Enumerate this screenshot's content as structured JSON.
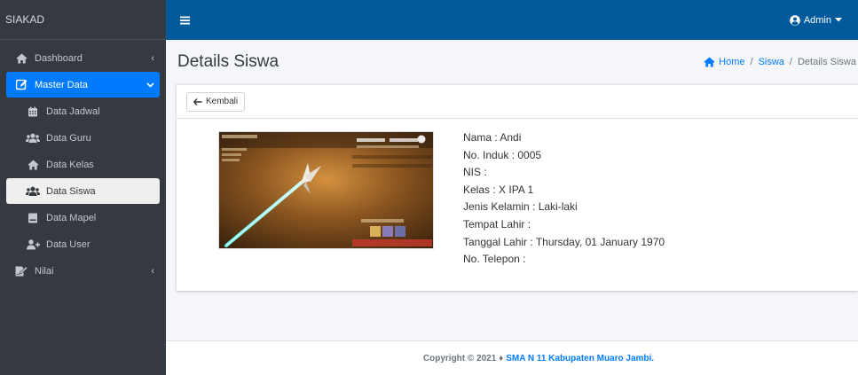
{
  "brand": "SIAKAD",
  "sidebar": {
    "items": [
      {
        "label": "Dashboard",
        "icon": "home-icon",
        "chevron": "‹"
      },
      {
        "label": "Master Data",
        "icon": "edit-icon",
        "chevron": "⌄"
      },
      {
        "label": "Data Jadwal",
        "icon": "calendar-icon"
      },
      {
        "label": "Data Guru",
        "icon": "users-icon"
      },
      {
        "label": "Data Kelas",
        "icon": "home-icon"
      },
      {
        "label": "Data Siswa",
        "icon": "users-icon"
      },
      {
        "label": "Data Mapel",
        "icon": "book-icon"
      },
      {
        "label": "Data User",
        "icon": "user-plus-icon"
      },
      {
        "label": "Nilai",
        "icon": "file-signature-icon",
        "chevron": "‹"
      }
    ]
  },
  "topbar": {
    "user_label": "Admin",
    "colors": {
      "navbar": "#005a9c",
      "sidebar": "#343a40",
      "accent": "#007bff"
    }
  },
  "header": {
    "title": "Details Siswa",
    "breadcrumb": {
      "home": "Home",
      "siswa": "Siswa",
      "current": "Details Siswa",
      "sep": "/"
    }
  },
  "card": {
    "back_label": "Kembali",
    "details": [
      "Nama : Andi",
      "No. Induk : 0005",
      "NIS :",
      "Kelas : X IPA 1",
      "Jenis Kelamin : Laki-laki",
      "Tempat Lahir :",
      "Tanggal Lahir : Thursday, 01 January 1970",
      "No. Telepon :"
    ]
  },
  "footer": {
    "copyright": "Copyright © 2021 ♦",
    "school": "SMA N 11 Kabupaten Muaro Jambi."
  }
}
